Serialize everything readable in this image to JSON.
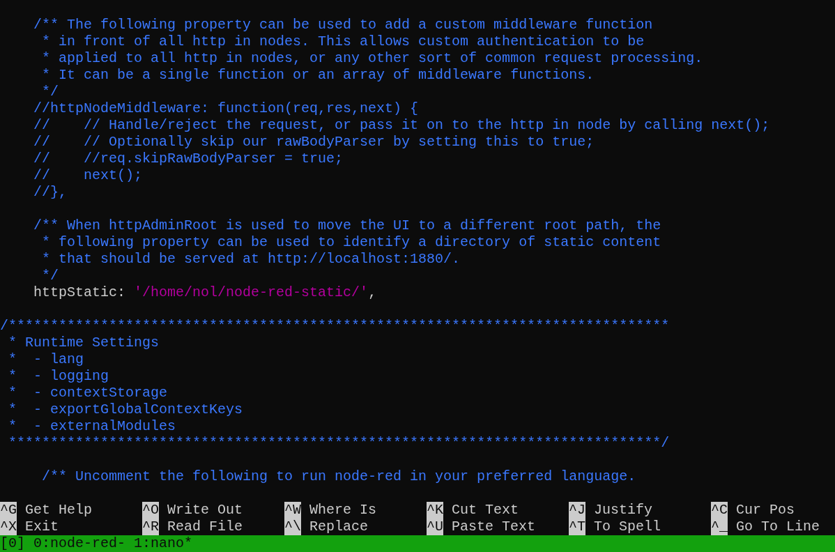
{
  "editor": {
    "lines": [
      {
        "kind": "comment",
        "text": "    /** The following property can be used to add a custom middleware function"
      },
      {
        "kind": "comment",
        "text": "     * in front of all http in nodes. This allows custom authentication to be"
      },
      {
        "kind": "comment",
        "text": "     * applied to all http in nodes, or any other sort of common request processing."
      },
      {
        "kind": "comment",
        "text": "     * It can be a single function or an array of middleware functions."
      },
      {
        "kind": "comment",
        "text": "     */"
      },
      {
        "kind": "comment",
        "text": "    //httpNodeMiddleware: function(req,res,next) {"
      },
      {
        "kind": "comment",
        "text": "    //    // Handle/reject the request, or pass it on to the http in node by calling next();"
      },
      {
        "kind": "comment",
        "text": "    //    // Optionally skip our rawBodyParser by setting this to true;"
      },
      {
        "kind": "comment",
        "text": "    //    //req.skipRawBodyParser = true;"
      },
      {
        "kind": "comment",
        "text": "    //    next();"
      },
      {
        "kind": "comment",
        "text": "    //},"
      },
      {
        "kind": "blank"
      },
      {
        "kind": "comment",
        "text": "    /** When httpAdminRoot is used to move the UI to a different root path, the"
      },
      {
        "kind": "comment",
        "text": "     * following property can be used to identify a directory of static content"
      },
      {
        "kind": "comment",
        "text": "     * that should be served at http://localhost:1880/."
      },
      {
        "kind": "comment",
        "text": "     */"
      },
      {
        "kind": "code",
        "segments": [
          {
            "kind": "plain",
            "text": "    httpStatic: "
          },
          {
            "kind": "string",
            "text": "'/home/nol/node-red-static/'"
          },
          {
            "kind": "plain",
            "text": ","
          }
        ]
      },
      {
        "kind": "blank"
      },
      {
        "kind": "comment",
        "text": "/*******************************************************************************"
      },
      {
        "kind": "comment",
        "text": " * Runtime Settings"
      },
      {
        "kind": "comment",
        "text": " *  - lang"
      },
      {
        "kind": "comment",
        "text": " *  - logging"
      },
      {
        "kind": "comment",
        "text": " *  - contextStorage"
      },
      {
        "kind": "comment",
        "text": " *  - exportGlobalContextKeys"
      },
      {
        "kind": "comment",
        "text": " *  - externalModules"
      },
      {
        "kind": "comment",
        "text": " ******************************************************************************/"
      },
      {
        "kind": "blank"
      },
      {
        "kind": "comment",
        "text": "     /** Uncomment the following to run node-red in your preferred language."
      }
    ]
  },
  "shortcut_bar": {
    "rows": [
      [
        {
          "key": "^G",
          "label": "Get Help"
        },
        {
          "key": "^O",
          "label": "Write Out"
        },
        {
          "key": "^W",
          "label": "Where Is"
        },
        {
          "key": "^K",
          "label": "Cut Text"
        },
        {
          "key": "^J",
          "label": "Justify"
        },
        {
          "key": "^C",
          "label": "Cur Pos"
        }
      ],
      [
        {
          "key": "^X",
          "label": "Exit"
        },
        {
          "key": "^R",
          "label": "Read File"
        },
        {
          "key": "^\\",
          "label": "Replace"
        },
        {
          "key": "^U",
          "label": "Paste Text"
        },
        {
          "key": "^T",
          "label": "To Spell"
        },
        {
          "key": "^_",
          "label": "Go To Line"
        }
      ]
    ]
  },
  "status_bar": {
    "session": "[0]",
    "windows": [
      "0:node-red-",
      "1:nano*"
    ]
  }
}
